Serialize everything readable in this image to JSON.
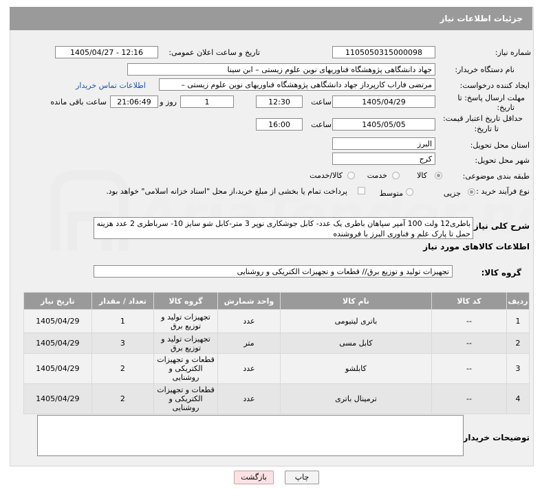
{
  "header": {
    "title": "جزئیات اطلاعات نیاز"
  },
  "fields": {
    "need_number_label": "شماره نیاز:",
    "need_number": "1105050315000098",
    "announce_label": "تاریخ و ساعت اعلان عمومی:",
    "announce_value": "1405/04/27 - 12:16",
    "buyer_org_label": "نام دستگاه خریدار:",
    "buyer_org": "جهاد دانشگاهی پژوهشگاه فناوریهای نوین علوم زیستی – ابن سینا",
    "creator_label": "ایجاد کننده درخواست:",
    "creator": "مرتضی فاراب کارپرداز جهاد دانشگاهی پژوهشگاه فناوریهای نوین علوم زیستی –",
    "contact_link": "اطلاعات تماس خریدار",
    "deadline_label_1": "مهلت ارسال پاسخ: تا",
    "deadline_label_2": "تاریخ:",
    "deadline_date": "1405/04/29",
    "time_label": "ساعت",
    "deadline_time": "12:30",
    "days_value": "1",
    "days_label": "روز و",
    "remaining_time": "21:06:49",
    "remaining_label": "ساعت باقی مانده",
    "validity_label_1": "حداقل تاریخ اعتبار قیمت:",
    "validity_label_2": "تا تاریخ:",
    "validity_date": "1405/05/05",
    "validity_time": "16:00",
    "province_label": "استان محل تحویل:",
    "province": "البرز",
    "city_label": "شهر محل تحویل:",
    "city": "کرج",
    "category_label": "طبقه بندی موضوعی:",
    "category_options": [
      "کالا",
      "خدمت",
      "کالا/خدمت"
    ],
    "category_selected": "کالا",
    "process_label": "نوع فرآیند خرید :",
    "process_options": [
      "جزیی",
      "متوسط"
    ],
    "process_selected": "جزیی",
    "payment_note": "پرداخت تمام یا بخشی از مبلغ خرید،از محل \"اسناد خزانه اسلامی\" خواهد بود."
  },
  "description": {
    "label": "شرح کلی نیاز:",
    "text": "باطری12 ولت 100 آمپر سپاهان باطری یک عدد- کابل جوشکاری نوپر 3 متر-کابل شو سایز 10- سرباطری 2 عدد هزینه حمل تا پارک علم و فناوری البرز با فروشنده"
  },
  "goods": {
    "section_title": "اطلاعات کالاهای مورد نیاز",
    "group_label": "گروه کالا:",
    "group_value": "تجهیزات تولید و توزیع برق// قطعات و تجهیزات الکتریکی و روشنایی",
    "columns": [
      "ردیف",
      "کد کالا",
      "نام کالا",
      "واحد شمارش",
      "گروه کالا",
      "تعداد / مقدار",
      "تاریخ نیاز"
    ],
    "rows": [
      {
        "row": "1",
        "code": "--",
        "name": "باتری لیتیومی",
        "unit": "عدد",
        "group": "تجهیزات تولید و توزیع برق",
        "qty": "1",
        "date": "1405/04/29"
      },
      {
        "row": "2",
        "code": "--",
        "name": "کابل مسی",
        "unit": "متر",
        "group": "تجهیزات تولید و توزیع برق",
        "qty": "3",
        "date": "1405/04/29"
      },
      {
        "row": "3",
        "code": "--",
        "name": "کابلشو",
        "unit": "عدد",
        "group": "قطعات و تجهیزات الکتریکی و روشنایی",
        "qty": "2",
        "date": "1405/04/29"
      },
      {
        "row": "4",
        "code": "--",
        "name": "ترمینال باتری",
        "unit": "عدد",
        "group": "قطعات و تجهیزات الکتریکی و روشنایی",
        "qty": "2",
        "date": "1405/04/29"
      }
    ]
  },
  "notes": {
    "label": "توضیحات خریدار:"
  },
  "buttons": {
    "print": "چاپ",
    "back": "بازگشت"
  },
  "watermark": {
    "text": "AriaTender.net"
  }
}
